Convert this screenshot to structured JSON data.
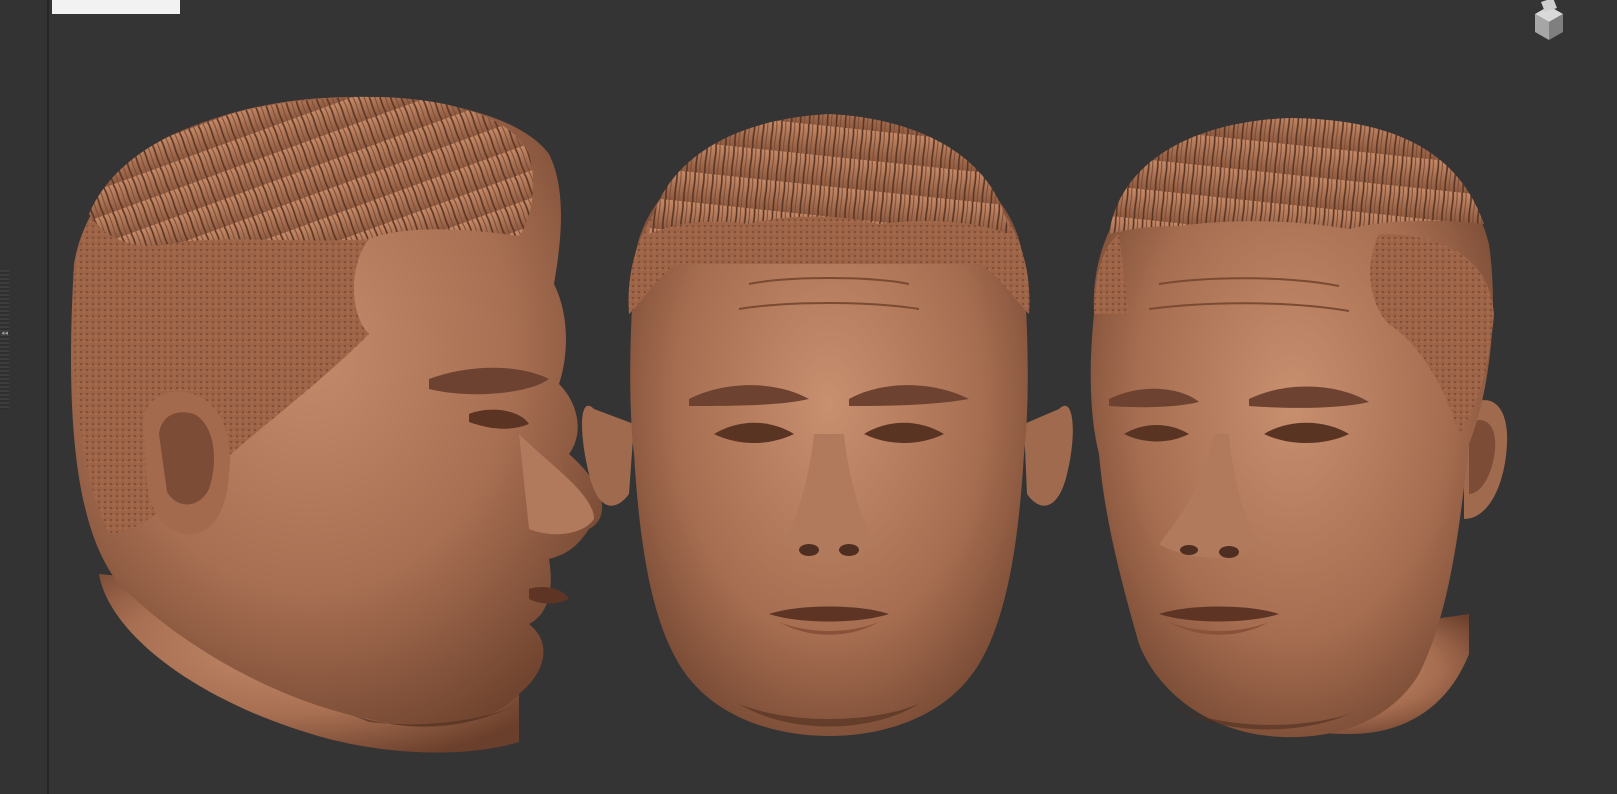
{
  "app": {
    "document_title": "",
    "brand_color": "#343434"
  },
  "viewport": {
    "background": "#343434",
    "material_color": "#b07b5e",
    "views": [
      {
        "name": "side-profile",
        "facing": "right"
      },
      {
        "name": "front",
        "facing": "front"
      },
      {
        "name": "three-quarter",
        "facing": "three-quarter-left"
      }
    ]
  },
  "gizmo": {
    "icon": "navigation-cube-icon"
  },
  "left_rail": {
    "icon": "collapse-arrows-icon",
    "arrows_glyph": "◂◂"
  }
}
